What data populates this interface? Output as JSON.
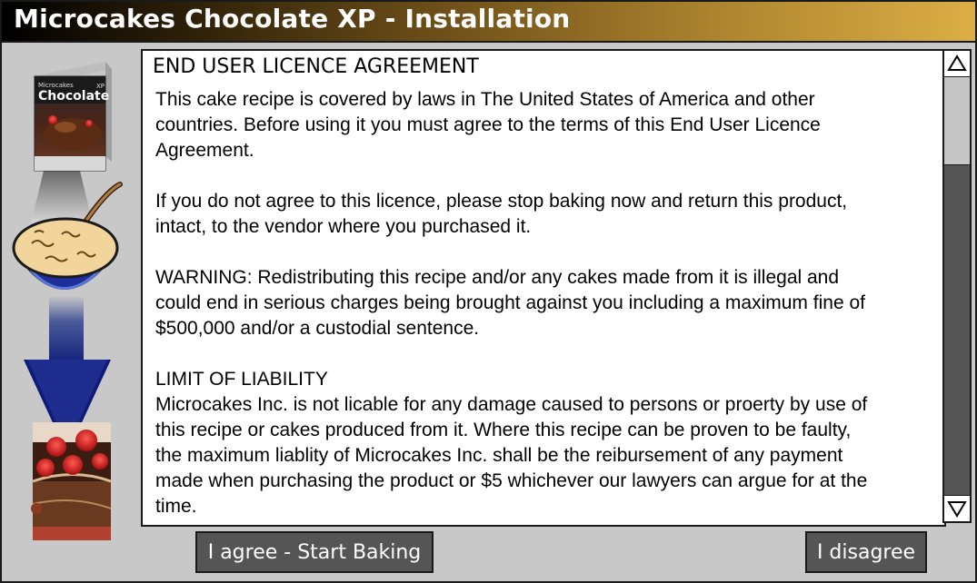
{
  "window": {
    "title": "Microcakes Chocolate XP - Installation"
  },
  "sidebar": {
    "box_brand": "Microcakes",
    "box_title": "Chocolate",
    "box_suffix": "XP",
    "icons": [
      "product-box-icon",
      "mixing-bowl-icon",
      "down-arrow-icon",
      "cake-slice-icon"
    ]
  },
  "agreement": {
    "heading": "END USER LICENCE AGREEMENT",
    "paragraphs": [
      [
        "This cake recipe is covered by laws in The United States of America and other",
        "countries. Before using it you must agree to the terms of this End User Licence",
        "Agreement."
      ],
      [
        "If you do not agree to this licence, please stop baking now and return this product,",
        "intact, to the vendor where you purchased it."
      ],
      [
        "WARNING: Redistributing this recipe and/or any cakes made from it is illegal and",
        "could end in serious charges being brought against you including a maximum fine of",
        "$500,000 and/or a custodial sentence."
      ],
      [
        "LIMIT OF LIABILITY",
        "Microcakes Inc. is not licable for any damage caused to persons or proerty by use of",
        "this recipe or cakes produced from it. Where this recipe can be proven to be faulty,",
        "the maximum liablity of Microcakes Inc. shall be the reibursement of any payment",
        "made when purchasing the product or $5 whichever our lawyers can argue for at the",
        "time."
      ]
    ]
  },
  "scrollbar": {
    "up_icon": "triangle-up-icon",
    "down_icon": "triangle-down-icon"
  },
  "buttons": {
    "agree_label": "I agree - Start Baking",
    "disagree_label": "I disagree"
  },
  "colors": {
    "title_gradient_start": "#000000",
    "title_gradient_end": "#dcae45",
    "background": "#c8c8c8",
    "button": "#555555",
    "bowl_blue": "#1f2f99",
    "batter": "#f1d59a"
  }
}
